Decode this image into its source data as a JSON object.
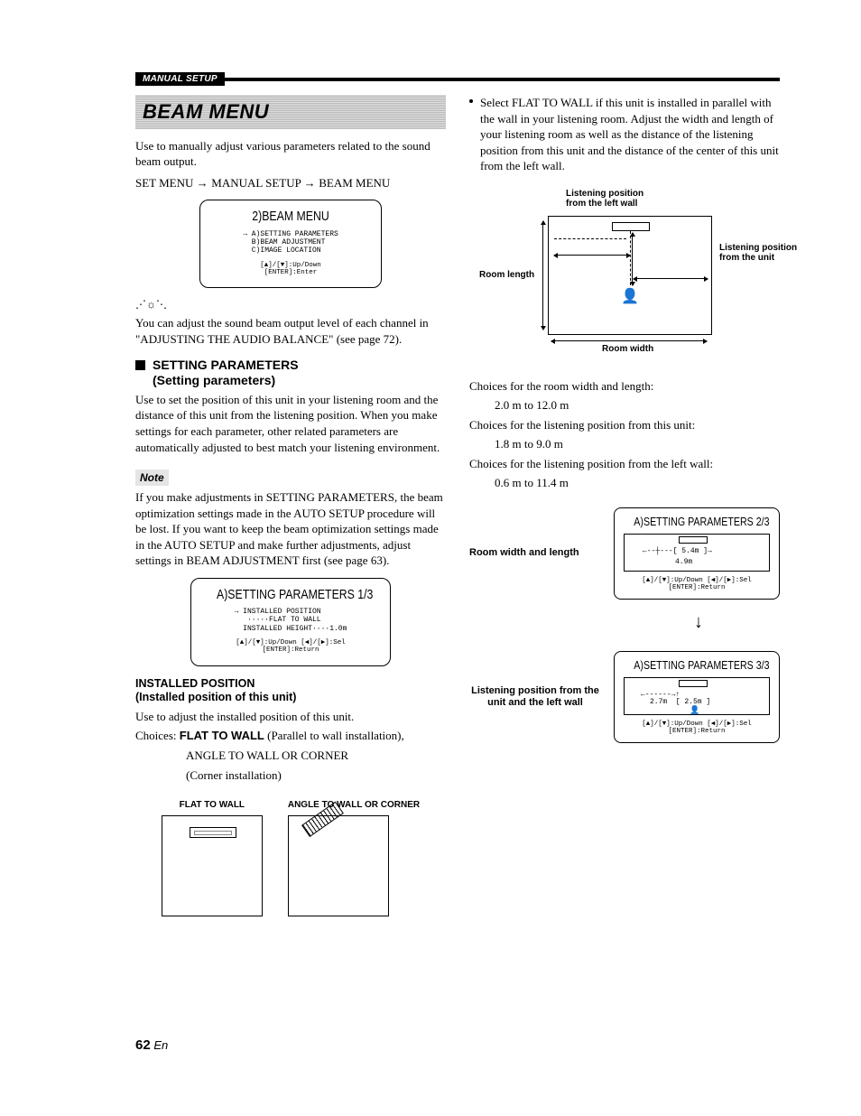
{
  "header": {
    "label": "MANUAL SETUP"
  },
  "beam": {
    "banner": "BEAM MENU",
    "intro": "Use to manually adjust various parameters related to the sound beam output.",
    "pathA": "SET MENU",
    "pathB": "MANUAL SETUP",
    "pathC": "BEAM MENU"
  },
  "lcdMain": {
    "title": "2)BEAM MENU",
    "body": "→ A)SETTING PARAMETERS\n  B)BEAM ADJUSTMENT\n  C)IMAGE LOCATION",
    "hint": "[▲]/[▼]:Up/Down\n[ENTER]:Enter"
  },
  "tip": "You can adjust the sound beam output level of each channel in \"ADJUSTING THE AUDIO BALANCE\" (see page 72).",
  "settingParams": {
    "title1": "SETTING PARAMETERS",
    "title2": "(Setting parameters)",
    "body": "Use to set the position of this unit in your listening room and the distance of this unit from the listening position. When you make settings for each parameter, other related parameters are automatically adjusted to best match your listening environment."
  },
  "note": {
    "label": "Note",
    "body": "If you make adjustments in SETTING PARAMETERS, the beam optimization settings made in the AUTO SETUP procedure will be lost. If you want to keep the beam optimization settings made in the AUTO SETUP and make further adjustments, adjust settings in BEAM ADJUSTMENT first (see page 63)."
  },
  "lcdParam1": {
    "title": "A)SETTING PARAMETERS 1/3",
    "body": "→ INSTALLED POSITION\n   ·····FLAT TO WALL\n  INSTALLED HEIGHT····1.0m",
    "hint": "[▲]/[▼]:Up/Down [◀]/[▶]:Sel\n[ENTER]:Return"
  },
  "installed": {
    "head1": "INSTALLED POSITION",
    "head2": "(Installed position of this unit)",
    "body": "Use to adjust the installed position of this unit.",
    "choicesPrefix": "Choices: ",
    "choice1Bold": "FLAT TO WALL",
    "choice1Rest": " (Parallel to wall installation),",
    "choice2a": "ANGLE TO WALL OR CORNER",
    "choice2b": "(Corner installation)",
    "labFlat": "FLAT TO WALL",
    "labAngle": "ANGLE TO WALL OR CORNER"
  },
  "select": {
    "body": "Select FLAT TO WALL if this unit is installed in parallel with the wall in your listening room. Adjust the width and length of your listening room as well as the distance of the listening position from this unit and the distance of the center of this unit from the left wall."
  },
  "roomFig": {
    "capTop": "Listening position\nfrom the left wall",
    "capRight": "Listening position\nfrom the unit",
    "capLeft": "Room length",
    "capBottom": "Room width"
  },
  "ranges": {
    "l1": "Choices for the room width and length:",
    "v1": "2.0 m to 12.0 m",
    "l2": "Choices for the listening position from this unit:",
    "v2": "1.8 m to 9.0 m",
    "l3": "Choices for the listening position from the left wall:",
    "v3": "0.6 m to 11.4 m"
  },
  "param23": {
    "rowLabel1": "Room width and length",
    "rowLabel2": "Listening position from the unit and the left wall",
    "lcd2Title": "A)SETTING PARAMETERS 2/3",
    "lcd2Vals": {
      "w": "5.4m",
      "l": "4.9m"
    },
    "lcd3Title": "A)SETTING PARAMETERS 3/3",
    "lcd3Vals": {
      "a": "2.7m",
      "b": "2.5m"
    },
    "hint": "[▲]/[▼]:Up/Down [◀]/[▶]:Sel\n[ENTER]:Return"
  },
  "pageNumber": {
    "num": "62",
    "suffix": "En"
  }
}
